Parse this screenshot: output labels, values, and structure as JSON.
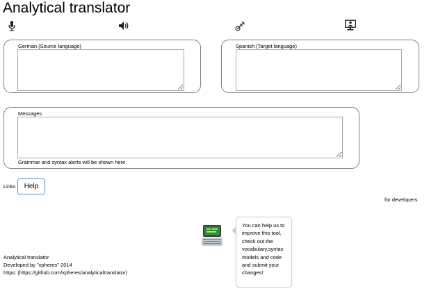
{
  "app": {
    "title": "Analytical translator"
  },
  "toolbar": {
    "mic_icon": "microphone-icon",
    "speaker_icon": "speaker-icon",
    "tool_icon": "tools-icon",
    "monitor_icon": "monitor-user-icon"
  },
  "source": {
    "label": "German (Source language)",
    "value": ""
  },
  "target": {
    "label": "Spanish (Target language)",
    "value": ""
  },
  "messages": {
    "label": "Messages",
    "value": "",
    "note": "Grammar and syntax alerts will be shown here"
  },
  "links": {
    "label": "Links",
    "help_button": "Help"
  },
  "developers": {
    "label": "for developers"
  },
  "promo": {
    "icon": "laptop-code-icon",
    "text": "You can help us to improve this tool, check out the vocabulary,syntax models and code and submit your changes!"
  },
  "footer": {
    "name": "Analytical translator",
    "developed_by": "Developed by \"xpheres\" 2014",
    "repo": "https: (https://github.com/xpheres/analyticaltranslator)"
  },
  "colors": {
    "border": "#7f7f7f",
    "button_border": "#5b8fc4"
  }
}
